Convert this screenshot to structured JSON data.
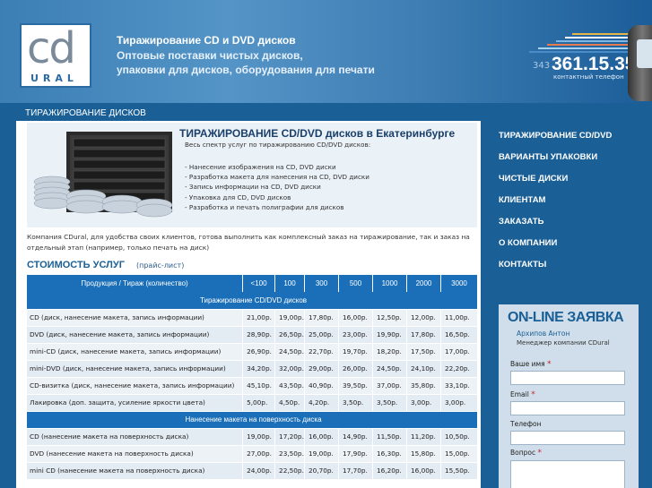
{
  "header": {
    "logo_top": "cd",
    "logo_bottom": "URAL",
    "line1": "Тиражирование CD и DVD дисков",
    "line2": "Оптовые поставки чистых дисков,",
    "line3": "упаковки для дисков, оборудования для печати",
    "phone_code": "343",
    "phone_number": "361.15.35",
    "phone_label": "контактный телефон"
  },
  "section_title": "ТИРАЖИРОВАНИЕ ДИСКОВ",
  "intro": {
    "title": "ТИРАЖИРОВАНИЕ CD/DVD дисков в Екатеринбурге",
    "subtitle": "Весь спектр услуг по тиражированию CD/DVD дисков:",
    "items": [
      "- Нанесение изображения на CD, DVD диски",
      "- Разработка макета для нанесения на CD, DVD диски",
      "- Запись информации на CD, DVD диски",
      "- Упаковка для CD, DVD дисков",
      "- Разработка и печать полиграфии для дисков"
    ]
  },
  "company_text": "Компания CDural, для удобства своих клиентов, готова выполнить как комплексный заказ на тиражирование, так и заказ на отдельный этап (например, только печать на диск)",
  "price": {
    "title": "СТОИМОСТЬ УСЛУГ",
    "subtitle": "(прайс-лист)",
    "headers": [
      "Продукция / Тираж (количество)",
      "<100",
      "100",
      "300",
      "500",
      "1000",
      "2000",
      "3000"
    ],
    "group1": "Тиражирование CD/DVD дисков",
    "rows1": [
      [
        "CD (диск, нанесение макета, запись информации)",
        "21,00р.",
        "19,00р.",
        "17,80р.",
        "16,00р.",
        "12,50р.",
        "12,00р.",
        "11,00р."
      ],
      [
        "DVD (диск, нанесение макета, запись информации)",
        "28,90р.",
        "26,50р.",
        "25,00р.",
        "23,00р.",
        "19,90р.",
        "17,80р.",
        "16,50р."
      ],
      [
        "mini-CD (диск, нанесение макета, запись информации)",
        "26,90р.",
        "24,50р.",
        "22,70р.",
        "19,70р.",
        "18,20р.",
        "17,50р.",
        "17,00р."
      ],
      [
        "mini-DVD (диск, нанесение макета, запись информации)",
        "34,20р.",
        "32,00р.",
        "29,00р.",
        "26,00р.",
        "24,50р.",
        "24,10р.",
        "22,20р."
      ],
      [
        "CD-визитка (диск, нанесение макета, запись информации)",
        "45,10р.",
        "43,50р.",
        "40,90р.",
        "39,50р.",
        "37,00р.",
        "35,80р.",
        "33,10р."
      ],
      [
        "Лакировка (доп. защита, усиление яркости цвета)",
        "5,00р.",
        "4,50р.",
        "4,20р.",
        "3,50р.",
        "3,50р.",
        "3,00р.",
        "3,00р."
      ]
    ],
    "group2": "Нанесение макета на поверхность диска",
    "rows2": [
      [
        "CD (нанесение макета на поверхность диска)",
        "19,00р.",
        "17,20р.",
        "16,00р.",
        "14,90р.",
        "11,50р.",
        "11,20р.",
        "10,50р."
      ],
      [
        "DVD (нанесение макета на поверхность диска)",
        "27,00р.",
        "23,50р.",
        "19,00р.",
        "17,90р.",
        "16,30р.",
        "15,80р.",
        "15,00р."
      ],
      [
        "mini CD (нанесение макета на поверхность диска)",
        "24,00р.",
        "22,50р.",
        "20,70р.",
        "17,70р.",
        "16,20р.",
        "16,00р.",
        "15,50р."
      ]
    ]
  },
  "nav": [
    "ТИРАЖИРОВАНИЕ CD/DVD",
    "ВАРИАНТЫ УПАКОВКИ",
    "ЧИСТЫЕ ДИСКИ",
    "КЛИЕНТАМ",
    "ЗАКАЗАТЬ",
    "О КОМПАНИИ",
    "КОНТАКТЫ"
  ],
  "order": {
    "title": "ON-LINE ЗАЯВКА",
    "manager_name": "Архипов Антон",
    "manager_role": "Менеджер компании CDural",
    "fields": [
      "Ваше имя",
      "Email",
      "Телефон",
      "Вопрос"
    ],
    "required_mark": "*"
  }
}
